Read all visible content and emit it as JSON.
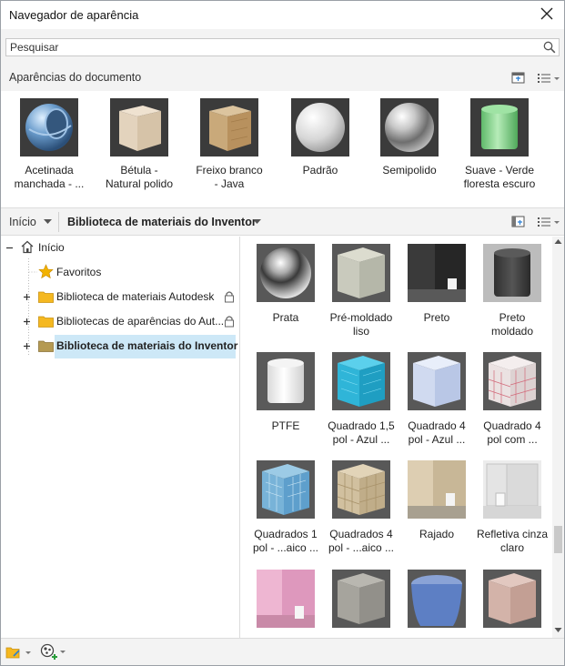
{
  "window": {
    "title": "Navegador de aparência"
  },
  "search": {
    "placeholder": "Pesquisar"
  },
  "document_section": {
    "label": "Aparências do documento",
    "items": [
      {
        "line1": "Acetinada",
        "line2": "manchada - ..."
      },
      {
        "line1": "Bétula -",
        "line2": "Natural polido"
      },
      {
        "line1": "Freixo branco",
        "line2": "- Java"
      },
      {
        "line1": "Padrão",
        "line2": ""
      },
      {
        "line1": "Semipolido",
        "line2": ""
      },
      {
        "line1": "Suave - Verde",
        "line2": "floresta escuro"
      }
    ]
  },
  "library_bar": {
    "home_label": "Início",
    "library_label": "Biblioteca de materiais do Inventor"
  },
  "tree": {
    "root": "Início",
    "favorites": "Favoritos",
    "items": [
      {
        "label": "Biblioteca de materiais Autodesk"
      },
      {
        "label": "Bibliotecas de aparências do Aut..."
      },
      {
        "label": "Biblioteca de materiais do Inventor"
      }
    ]
  },
  "grid": {
    "items": [
      {
        "line1": "Prata",
        "line2": ""
      },
      {
        "line1": "Pré-moldado",
        "line2": "liso"
      },
      {
        "line1": "Preto",
        "line2": ""
      },
      {
        "line1": "Preto",
        "line2": "moldado"
      },
      {
        "line1": "PTFE",
        "line2": ""
      },
      {
        "line1": "Quadrado 1,5",
        "line2": "pol - Azul ..."
      },
      {
        "line1": "Quadrado 4",
        "line2": "pol - Azul ..."
      },
      {
        "line1": "Quadrado 4",
        "line2": "pol com ..."
      },
      {
        "line1": "Quadrados 1",
        "line2": "pol - ...aico ..."
      },
      {
        "line1": "Quadrados 4",
        "line2": "pol - ...aico ..."
      },
      {
        "line1": "Rajado",
        "line2": ""
      },
      {
        "line1": "Refletiva cinza",
        "line2": "claro"
      }
    ]
  }
}
